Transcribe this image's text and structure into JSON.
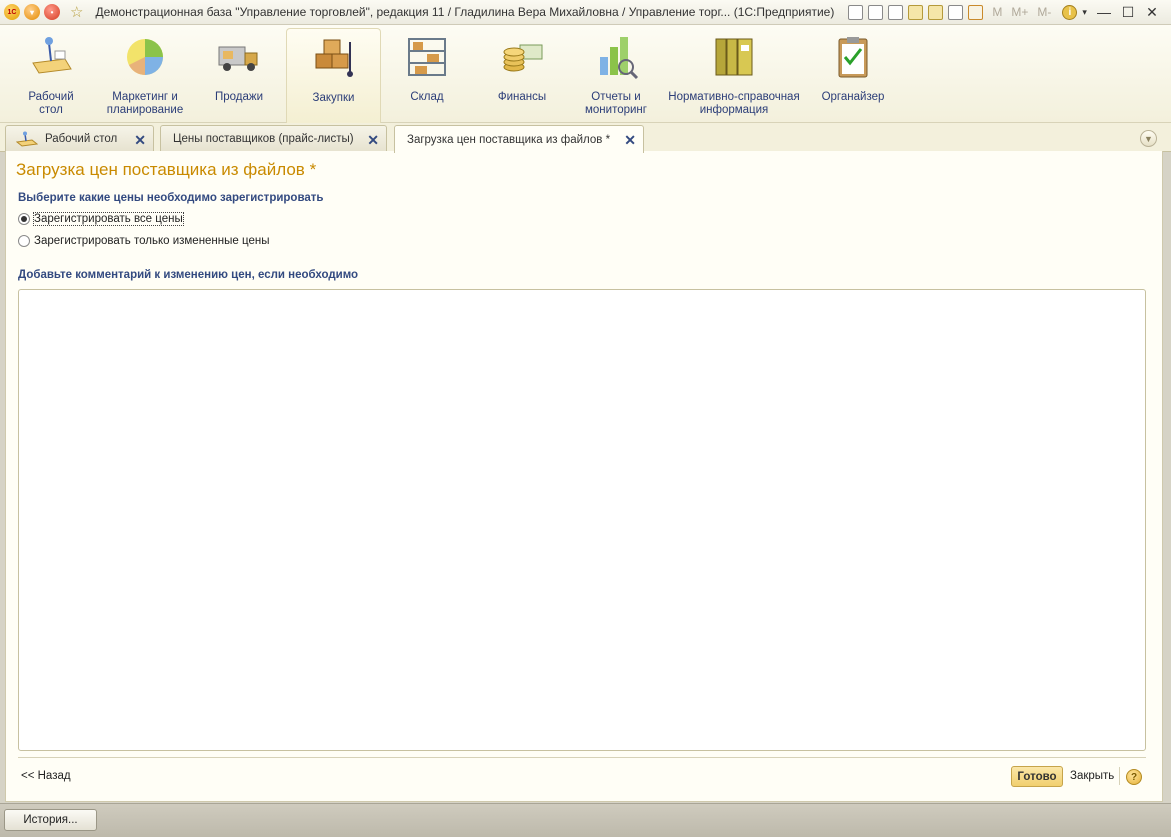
{
  "window": {
    "title": "Демонстрационная база \"Управление торговлей\", редакция 11 / Гладилина Вера Михайловна / Управление торг...  (1С:Предприятие)",
    "toolbar_m_labels": [
      "M",
      "M+",
      "M-"
    ]
  },
  "sections": [
    {
      "label": "Рабочий\nстол",
      "icon": "desk-icon"
    },
    {
      "label": "Маркетинг и\nпланирование",
      "icon": "pie-chart-icon"
    },
    {
      "label": "Продажи",
      "icon": "truck-icon"
    },
    {
      "label": "Закупки",
      "icon": "boxes-cart-icon",
      "active": true
    },
    {
      "label": "Склад",
      "icon": "shelves-icon"
    },
    {
      "label": "Финансы",
      "icon": "coins-icon"
    },
    {
      "label": "Отчеты и\nмониторинг",
      "icon": "bar-chart-icon"
    },
    {
      "label": "Нормативно-справочная\nинформация",
      "icon": "binders-icon"
    },
    {
      "label": "Органайзер",
      "icon": "clipboard-icon"
    }
  ],
  "tabs": [
    {
      "label": "Рабочий стол"
    },
    {
      "label": "Цены поставщиков (прайс-листы)"
    },
    {
      "label": "Загрузка цен поставщика из файлов *",
      "active": true
    }
  ],
  "form": {
    "title": "Загрузка цен поставщика из файлов *",
    "price_choice_label": "Выберите какие цены необходимо зарегистрировать",
    "options": [
      {
        "label": "Зарегистрировать все цены",
        "checked": true
      },
      {
        "label": "Зарегистрировать только измененные цены",
        "checked": false
      }
    ],
    "comment_label": "Добавьте комментарий к изменению цен, если необходимо",
    "comment_value": "",
    "back_label": "<< Назад",
    "ready_label": "Готово",
    "close_label": "Закрыть",
    "help_label": "?"
  },
  "bottom": {
    "history_label": "История..."
  }
}
